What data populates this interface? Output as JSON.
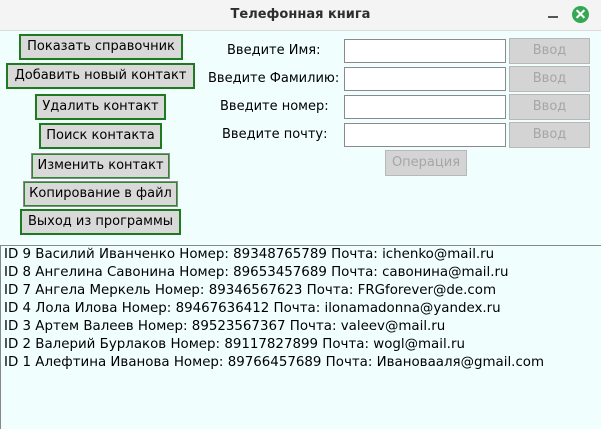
{
  "window": {
    "title": "Телефонная книга"
  },
  "menu_buttons": [
    "Показать справочник",
    "Добавить новый контакт",
    "Удалить контакт",
    "Поиск контакта",
    "Изменить контакт",
    "Копирование в файл",
    "Выход из программы"
  ],
  "form": {
    "fields": [
      {
        "label": "Введите Имя:",
        "value": "",
        "button": "Ввод"
      },
      {
        "label": "Введите Фамилию:",
        "value": "",
        "button": "Ввод"
      },
      {
        "label": "Введите номер:",
        "value": "",
        "button": "Ввод"
      },
      {
        "label": "Введите почту:",
        "value": "",
        "button": "Ввод"
      }
    ],
    "operation_button": "Операция"
  },
  "contacts": [
    "ID 9 Василий Иванченко Номер: 89348765789 Почта: ichenko@mail.ru",
    "ID 8 Ангелина Савонина Номер: 89653457689 Почта: савонина@mail.ru",
    "ID 7 Ангела Меркель Номер: 89346567623 Почта: FRGforever@de.com",
    "ID 4 Лола Илова Номер: 89467636412 Почта: ilonamadonna@yandex.ru",
    "ID 3 Артем Валеев Номер: 89523567367 Почта: valeev@mail.ru",
    "ID 2 Валерий Бурлаков Номер: 89117827899 Почта: wogl@mail.ru",
    "ID 1 Алефтина Иванова Номер: 89766457689 Почта: Ивановааля@gmail.com"
  ]
}
